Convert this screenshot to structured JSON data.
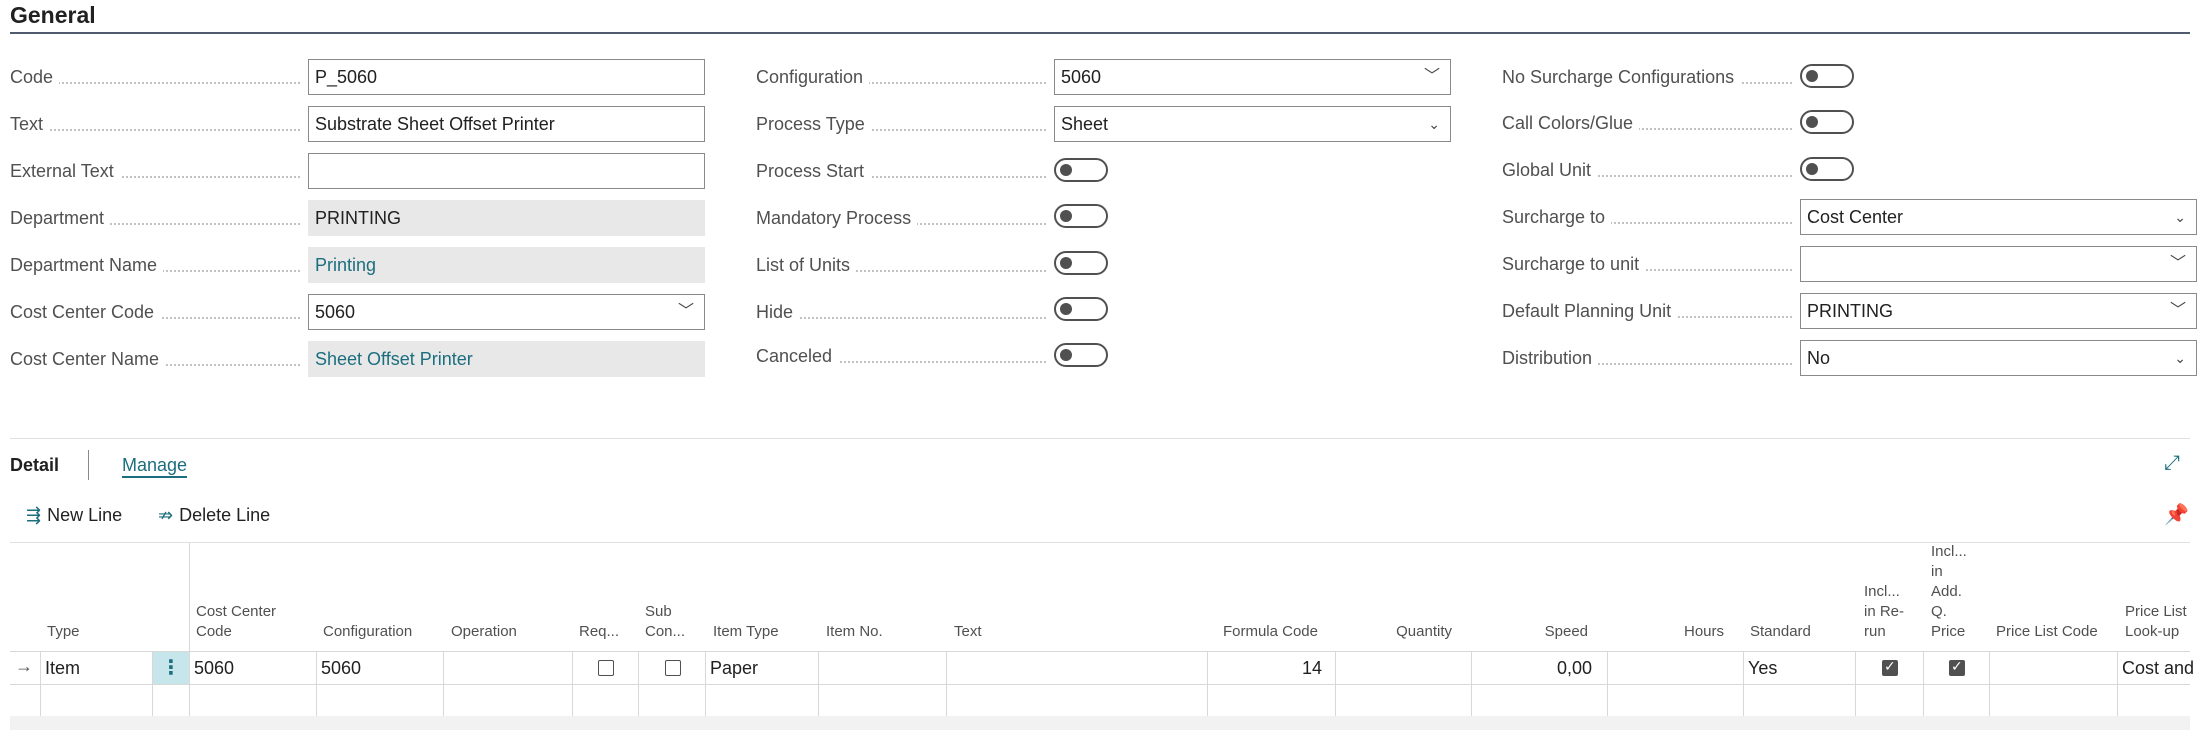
{
  "section": {
    "title": "General"
  },
  "col1": {
    "code": {
      "label": "Code",
      "value": "P_5060"
    },
    "text": {
      "label": "Text",
      "value": "Substrate Sheet Offset Printer"
    },
    "external_text": {
      "label": "External Text",
      "value": ""
    },
    "department": {
      "label": "Department",
      "value": "PRINTING"
    },
    "department_name": {
      "label": "Department Name",
      "value": "Printing"
    },
    "cost_center_code": {
      "label": "Cost Center Code",
      "value": "5060"
    },
    "cost_center_name": {
      "label": "Cost Center Name",
      "value": "Sheet Offset Printer"
    }
  },
  "col2": {
    "configuration": {
      "label": "Configuration",
      "value": "5060"
    },
    "process_type": {
      "label": "Process Type",
      "value": "Sheet"
    },
    "process_start": {
      "label": "Process Start"
    },
    "mandatory_process": {
      "label": "Mandatory Process"
    },
    "list_of_units": {
      "label": "List of Units"
    },
    "hide": {
      "label": "Hide"
    },
    "canceled": {
      "label": "Canceled"
    }
  },
  "col3": {
    "no_surcharge": {
      "label": "No Surcharge Configurations"
    },
    "call_colors": {
      "label": "Call Colors/Glue"
    },
    "global_unit": {
      "label": "Global Unit"
    },
    "surcharge_to": {
      "label": "Surcharge to",
      "value": "Cost Center"
    },
    "surcharge_to_unit": {
      "label": "Surcharge to unit",
      "value": ""
    },
    "default_planning_unit": {
      "label": "Default Planning Unit",
      "value": "PRINTING"
    },
    "distribution": {
      "label": "Distribution",
      "value": "No"
    }
  },
  "tabs": {
    "detail": "Detail",
    "manage": "Manage"
  },
  "actions": {
    "new_line": "New Line",
    "delete_line": "Delete Line"
  },
  "grid": {
    "headers": {
      "type": "Type",
      "cost_center_code_1": "Cost Center",
      "cost_center_code_2": "Code",
      "configuration": "Configuration",
      "operation": "Operation",
      "req": "Req...",
      "sub_con_1": "Sub",
      "sub_con_2": "Con...",
      "item_type": "Item Type",
      "item_no": "Item No.",
      "text": "Text",
      "formula_code": "Formula Code",
      "quantity": "Quantity",
      "speed": "Speed",
      "hours": "Hours",
      "standard": "Standard",
      "incl_rerun_1": "Incl...",
      "incl_rerun_2": "in Re-",
      "incl_rerun_3": "run",
      "incl_add_1": "Incl...",
      "incl_add_2": "in",
      "incl_add_3": "Add.",
      "incl_add_4": "Q.",
      "incl_add_5": "Price",
      "price_list_code": "Price List Code",
      "price_lookup_1": "Price List",
      "price_lookup_2": "Look-up"
    },
    "row": {
      "type": "Item",
      "cost_center_code": "5060",
      "configuration": "5060",
      "item_type": "Paper",
      "formula_code": "14",
      "speed": "0,00",
      "standard": "Yes",
      "price_lookup": "Cost and"
    }
  }
}
